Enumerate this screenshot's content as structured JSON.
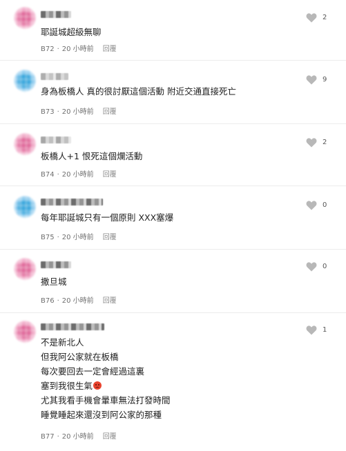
{
  "comments": [
    {
      "avatar_color": "pink",
      "lines": [
        "耶誕城超級無聊"
      ],
      "floor": "B72",
      "time": "20 小時前",
      "reply_label": "回覆",
      "likes": "2"
    },
    {
      "avatar_color": "blue",
      "lines": [
        "身為板橋人 真的很討厭這個活動 附近交通直接死亡"
      ],
      "floor": "B73",
      "time": "20 小時前",
      "reply_label": "回覆",
      "likes": "9"
    },
    {
      "avatar_color": "pink",
      "lines": [
        "板橋人+1 恨死這個爛活動"
      ],
      "floor": "B74",
      "time": "20 小時前",
      "reply_label": "回覆",
      "likes": "2"
    },
    {
      "avatar_color": "blue",
      "lines": [
        "每年耶誕城只有一個原則 XXX塞爆"
      ],
      "floor": "B75",
      "time": "20 小時前",
      "reply_label": "回覆",
      "likes": "0"
    },
    {
      "avatar_color": "pink",
      "lines": [
        "撒旦城"
      ],
      "floor": "B76",
      "time": "20 小時前",
      "reply_label": "回覆",
      "likes": "0"
    },
    {
      "avatar_color": "pink",
      "lines": [
        "不是新北人",
        "但我阿公家就在板橋",
        "每次要回去一定會經過這裏",
        "塞到我很生氣",
        "尤其我看手機會暈車無法打發時間",
        "睡覺睡起來還沒到阿公家的那種"
      ],
      "emoji": "angry-face",
      "floor": "B77",
      "time": "20 小時前",
      "reply_label": "回覆",
      "likes": "1"
    }
  ]
}
